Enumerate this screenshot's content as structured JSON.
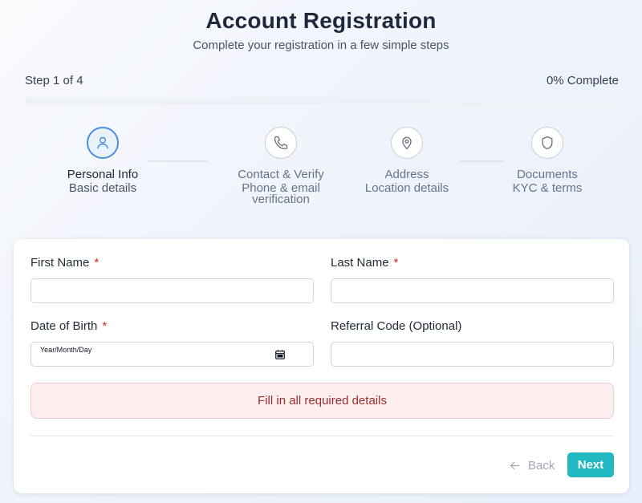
{
  "header": {
    "title": "Account Registration",
    "subtitle": "Complete your registration in a few simple steps"
  },
  "progress": {
    "step_text": "Step 1 of 4",
    "complete_text": "0% Complete",
    "percent": 0
  },
  "steps": [
    {
      "label": "Personal Info",
      "sub": "Basic details",
      "icon": "user-icon",
      "active": true
    },
    {
      "label": "Contact & Verify",
      "sub": "Phone & email verification",
      "icon": "phone-icon",
      "active": false
    },
    {
      "label": "Address",
      "sub": "Location details",
      "icon": "location-pin-icon",
      "active": false
    },
    {
      "label": "Documents",
      "sub": "KYC & terms",
      "icon": "shield-icon",
      "active": false
    }
  ],
  "form": {
    "first_name": {
      "label": "First Name",
      "required_mark": "*",
      "value": ""
    },
    "last_name": {
      "label": "Last Name",
      "required_mark": "*",
      "value": ""
    },
    "dob": {
      "label": "Date of Birth",
      "required_mark": "*",
      "placeholder": "Year/Month/Day"
    },
    "referral": {
      "label": "Referral Code (Optional)",
      "value": ""
    }
  },
  "alert": {
    "message": "Fill in all required details"
  },
  "buttons": {
    "back_label": "Back",
    "next_label": "Next"
  },
  "colors": {
    "accent": "#22b8c2",
    "active_step": "#4a90d9",
    "alert_text": "#9b2c2c",
    "required": "#dc2626"
  }
}
